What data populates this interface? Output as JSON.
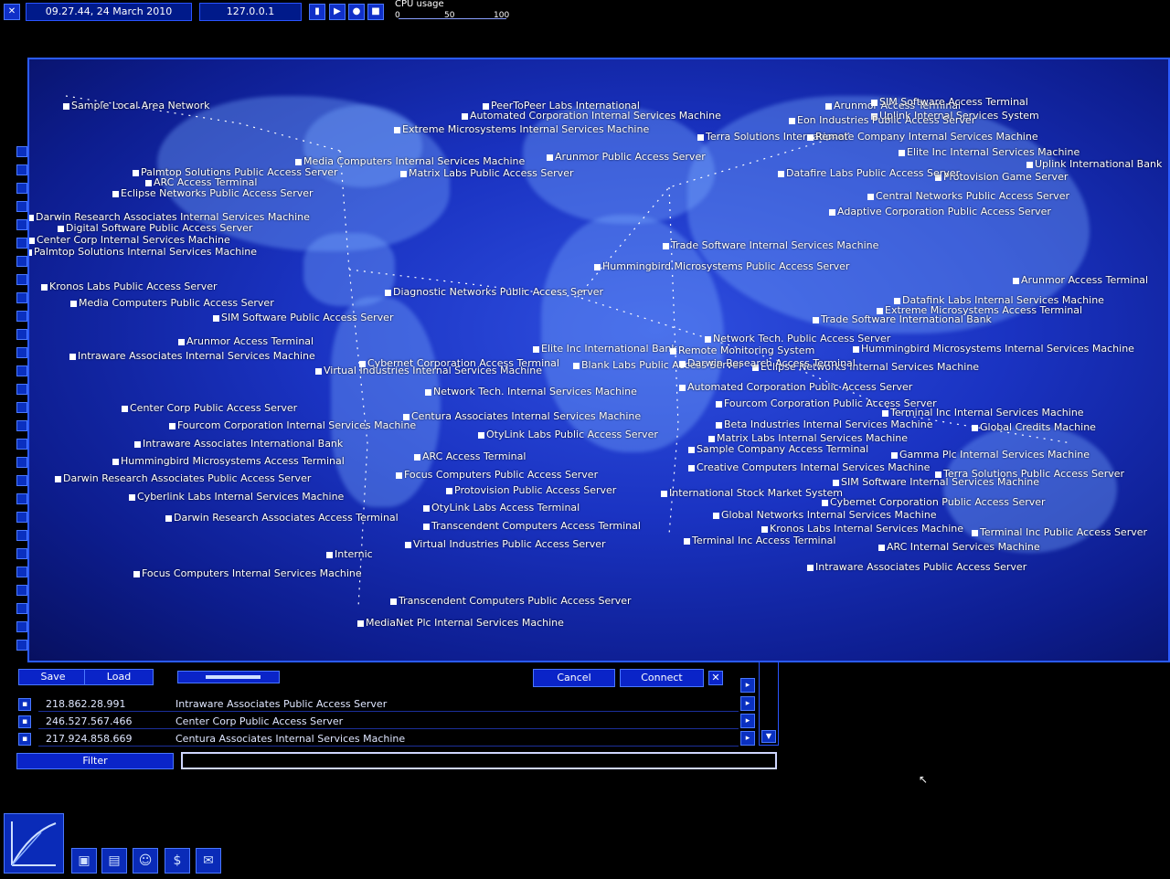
{
  "topbar": {
    "datetime": "09.27.44, 24 March 2010",
    "ip": "127.0.0.1",
    "cpu_label": "CPU usage",
    "cpu_ticks": [
      "0",
      "50",
      "100"
    ]
  },
  "map": {
    "labels": [
      "Sample Local Area Network",
      "PeerToPeer Labs International",
      "Automated Corporation Internal Services Machine",
      "Extreme Microsystems Internal Services Machine",
      "Arunmor Access Terminal",
      "SIM Software Access Terminal",
      "Uplink Internal Services System",
      "Eon Industries Public Access Server",
      "Terra Solutions International",
      "Remote Company Internal Services Machine",
      "Elite Inc Internal Services Machine",
      "Uplink International Bank",
      "Digital Software Public Access Server",
      "Arunmor Public Access Server",
      "Media Computers Internal Services Machine",
      "Matrix Labs Public Access Server",
      "Palmtop Solutions Public Access Server",
      "ARC Access Terminal",
      "Eclipse Networks Public Access Server",
      "Darwin Research Associates Internal Services Machine",
      "Center Corp Internal Services Machine",
      "Palmtop Solutions Internal Services Machine",
      "Kronos Labs Public Access Server",
      "Media Computers Public Access Server",
      "SIM Software Public Access Server",
      "Arunmor Access Terminal",
      "Intraware Associates Internal Services Machine",
      "Virtual Industries Internal Services Machine",
      "Cybernet Corporation Access Terminal",
      "Network Tech. Internal Services Machine",
      "Centura Associates Internal Services Machine",
      "OtyLink Labs Public Access Server",
      "ARC Access Terminal",
      "Focus Computers Public Access Server",
      "Protovision Public Access Server",
      "OtyLink Labs Access Terminal",
      "Transcendent Computers Access Terminal",
      "Virtual Industries Public Access Server",
      "Internic",
      "Focus Computers Internal Services Machine",
      "Transcendent Computers Public Access Server",
      "MediaNet Plc Internal Services Machine",
      "Center Corp Public Access Server",
      "Fourcom Corporation Internal Services Machine",
      "Intraware Associates International Bank",
      "Hummingbird Microsystems Access Terminal",
      "Darwin Research Associates Public Access Server",
      "Cyberlink Labs Internal Services Machine",
      "Darwin Research Associates Access Terminal",
      "Protovision Game Server",
      "Datafire Labs Public Access Server",
      "Central Networks Public Access Server",
      "Adaptive Corporation Public Access Server",
      "Arunmor Access Terminal",
      "Datafink Labs Internal Services Machine",
      "Extreme Microsystems Access Terminal",
      "Hummingbird Microsystems Internal Services Machine",
      "Eclipse Networks Internal Services Machine",
      "Automated Corporation Public Access Server",
      "Fourcom Corporation Public Access Server",
      "Terminal Inc Internal Services Machine",
      "Beta Industries Internal Services Machine",
      "Global Credits Machine",
      "Matrix Labs Internal Services Machine",
      "Sample Company Access Terminal",
      "Gamma Plc Internal Services Machine",
      "Creative Computers Internal Services Machine",
      "Terra Solutions Public Access Server",
      "SIM Software Internal Services Machine",
      "International Stock Market System",
      "Cybernet Corporation Public Access Server",
      "Global Networks Internal Services Machine",
      "Kronos Labs Internal Services Machine",
      "Terminal Inc Public Access Server",
      "Terminal Inc Access Terminal",
      "ARC Internal Services Machine",
      "Intraware Associates Public Access Server",
      "Network Tech. Public Access Server",
      "Trade Software International Bank",
      "Elite Inc International Bank",
      "Remote Monitoring System",
      "Blank Labs Public Access Server",
      "Darwin Research Access Terminal",
      "Hummingbird Microsystems Public Access Server",
      "Trade Software Internal Services Machine",
      "Diagnostic Networks Public Access Server"
    ]
  },
  "panel": {
    "save_label": "Save",
    "load_label": "Load",
    "cancel_label": "Cancel",
    "connect_label": "Connect",
    "rows": [
      {
        "ip": "218.862.28.991",
        "name": "Intraware Associates Public Access Server"
      },
      {
        "ip": "246.527.567.466",
        "name": "Center Corp Public Access Server"
      },
      {
        "ip": "217.924.858.669",
        "name": "Centura Associates Internal Services Machine"
      }
    ],
    "filter_label": "Filter",
    "filter_value": ""
  }
}
